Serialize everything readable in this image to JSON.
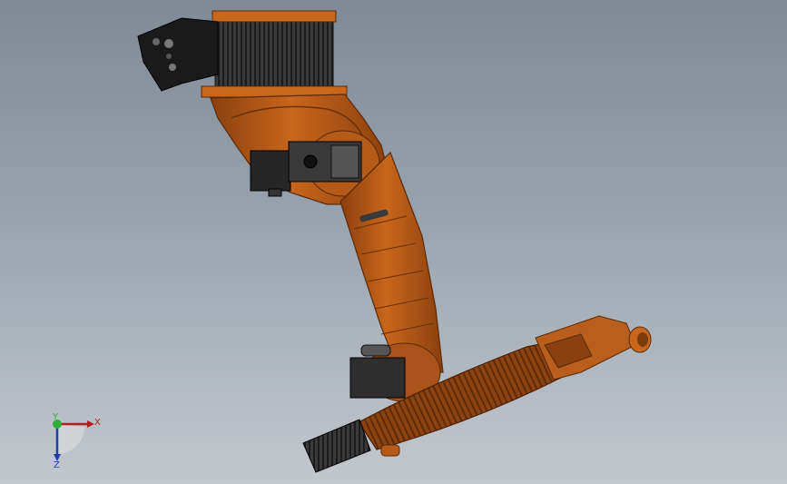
{
  "view": {
    "background_top": "#7f8a97",
    "background_bottom": "#c3c8cd",
    "model_color": "#c8661c",
    "model_shade": "#8a3f0e",
    "motor_color": "#2a2a2a"
  },
  "triad": {
    "x_label": "X",
    "y_label": "Y",
    "z_label": "Z",
    "x_color": "#b21e1e",
    "y_color": "#2fae3a",
    "z_color": "#1e3fa8"
  }
}
